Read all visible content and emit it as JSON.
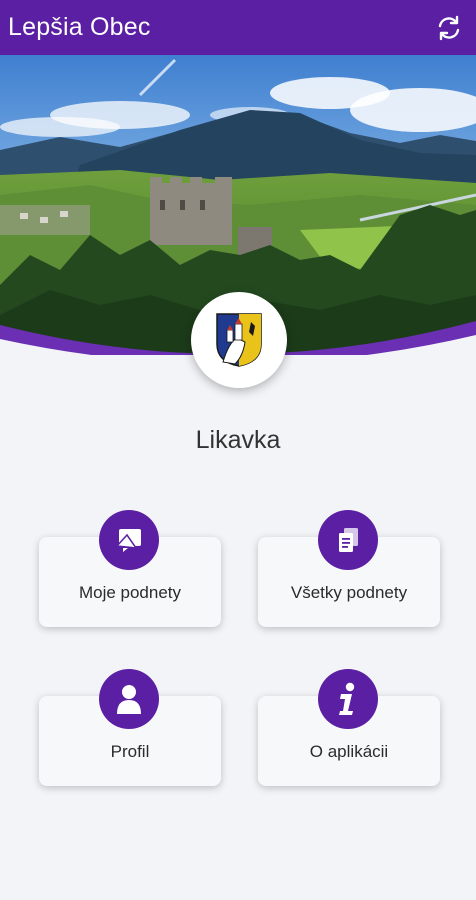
{
  "app": {
    "title": "Lepšia Obec"
  },
  "header": {
    "refresh_icon": "refresh-icon"
  },
  "village": {
    "name": "Likavka",
    "crest_icon": "coat-of-arms"
  },
  "menu": {
    "my_reports": "Moje podnety",
    "all_reports": "Všetky podnety",
    "profile": "Profil",
    "about": "O aplikácii"
  },
  "colors": {
    "primary": "#5b1fa3",
    "background": "#f2f4f7"
  }
}
